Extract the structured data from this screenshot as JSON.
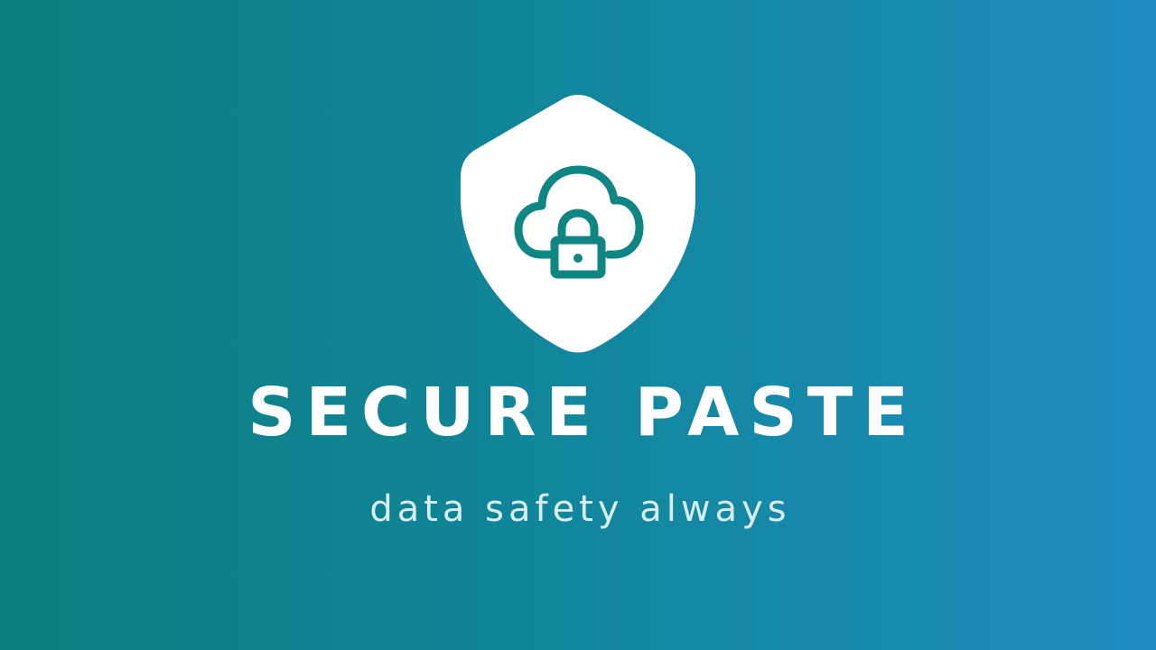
{
  "brand": {
    "title": "SECURE PASTE",
    "tagline": "data safety always",
    "icon": "shield-cloud-lock-icon"
  },
  "colors": {
    "background_start": "#0a7e7f",
    "background_end": "#1e8cc0",
    "shield_fill": "#ffffff",
    "icon_stroke": "#0f8584",
    "title_color": "#ffffff",
    "tagline_color": "#d9eef2"
  }
}
